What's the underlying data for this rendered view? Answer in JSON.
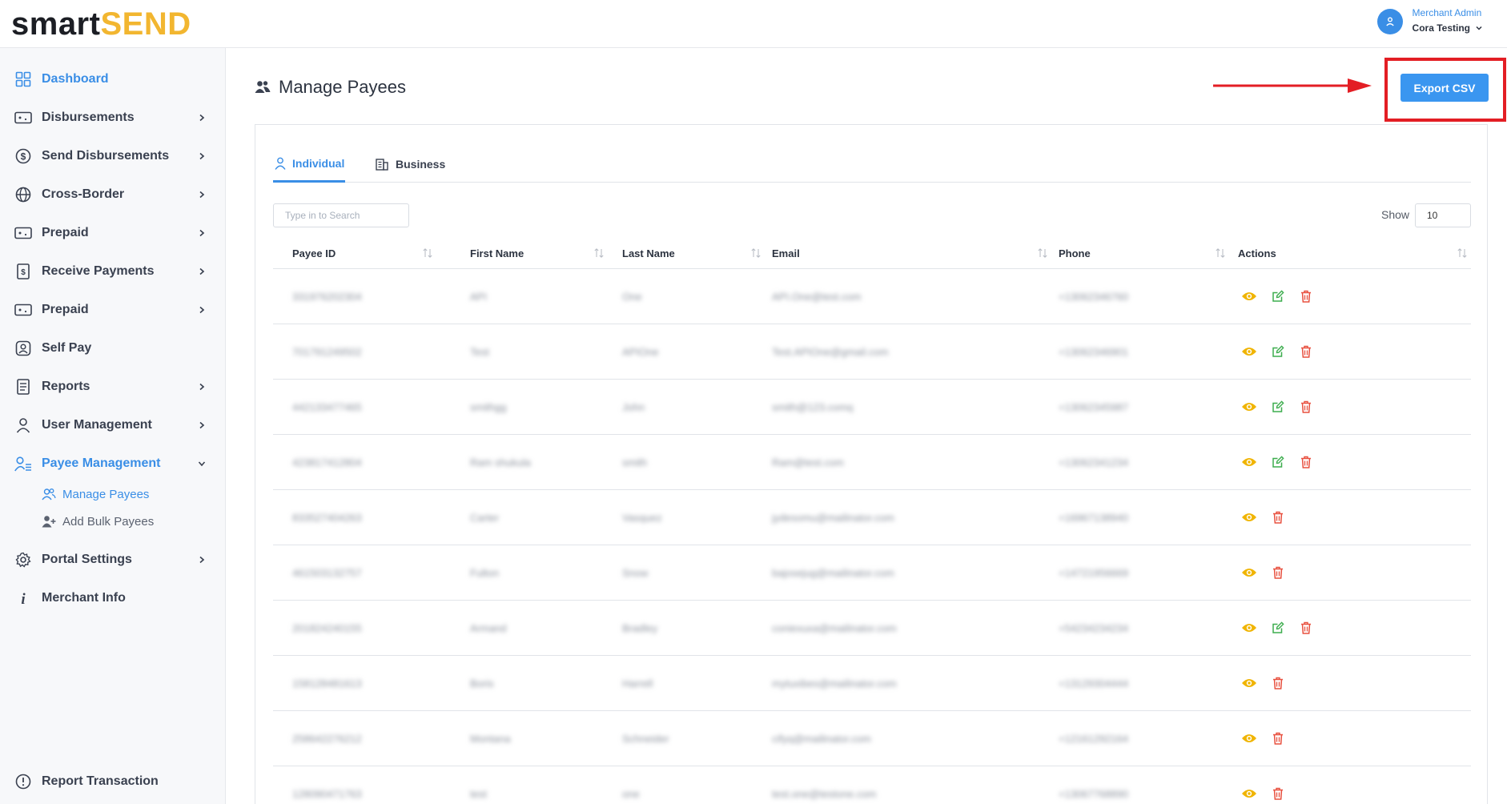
{
  "brand": {
    "part1": "smart",
    "part2": "SEND"
  },
  "user": {
    "role": "Merchant Admin",
    "name": "Cora Testing"
  },
  "sidebar": {
    "items": [
      {
        "label": "Dashboard",
        "icon": "dashboard-icon",
        "active": true,
        "has_chevron": false
      },
      {
        "label": "Disbursements",
        "icon": "cash-icon",
        "has_chevron": true
      },
      {
        "label": "Send Disbursements",
        "icon": "dollar-circle-icon",
        "has_chevron": true
      },
      {
        "label": "Cross-Border",
        "icon": "globe-icon",
        "has_chevron": true
      },
      {
        "label": "Prepaid",
        "icon": "cash-icon",
        "has_chevron": true
      },
      {
        "label": "Receive Payments",
        "icon": "receipt-icon",
        "has_chevron": true
      },
      {
        "label": "Prepaid",
        "icon": "cash-icon",
        "has_chevron": true
      },
      {
        "label": "Self Pay",
        "icon": "user-square-icon",
        "has_chevron": false
      },
      {
        "label": "Reports",
        "icon": "report-icon",
        "has_chevron": true
      },
      {
        "label": "User Management",
        "icon": "user-icon",
        "has_chevron": true
      },
      {
        "label": "Payee Management",
        "icon": "user-list-icon",
        "active": true,
        "has_chevron": true,
        "expanded": true
      },
      {
        "label": "Portal Settings",
        "icon": "gear-icon",
        "has_chevron": true
      },
      {
        "label": "Merchant Info",
        "icon": "info-icon",
        "has_chevron": false
      }
    ],
    "sub_items": [
      {
        "label": "Manage Payees",
        "icon": "users-icon",
        "active": true
      },
      {
        "label": "Add Bulk Payees",
        "icon": "user-plus-icon"
      }
    ],
    "bottom_item": {
      "label": "Report Transaction",
      "icon": "alert-circle-icon"
    }
  },
  "page": {
    "title": "Manage Payees",
    "export_label": "Export CSV"
  },
  "tabs": [
    {
      "label": "Individual",
      "icon": "person-icon",
      "active": true
    },
    {
      "label": "Business",
      "icon": "building-icon",
      "active": false
    }
  ],
  "search": {
    "placeholder": "Type in to Search",
    "value": ""
  },
  "show": {
    "label": "Show",
    "value": "10"
  },
  "table": {
    "columns": [
      "Payee ID",
      "First Name",
      "Last Name",
      "Email",
      "Phone",
      "Actions"
    ],
    "rows": [
      {
        "id": "331976202304",
        "first": "API",
        "last": "One",
        "email": "API.One@test.com",
        "phone": "+13062346760",
        "editable": true
      },
      {
        "id": "701791249502",
        "first": "Test",
        "last": "APIOne",
        "email": "Test.APIOne@gmail.com",
        "phone": "+13062346901",
        "editable": true
      },
      {
        "id": "442133477465",
        "first": "smithgg",
        "last": "John",
        "email": "smith@123.comq",
        "phone": "+13062345987",
        "editable": true
      },
      {
        "id": "423817412804",
        "first": "Ram shukula",
        "last": "smith",
        "email": "Ram@test.com",
        "phone": "+13062341234",
        "editable": true
      },
      {
        "id": "833527404263",
        "first": "Carter",
        "last": "Vasquez",
        "email": "jydesomu@mailinator.com",
        "phone": "+16967138940",
        "editable": false
      },
      {
        "id": "461503132757",
        "first": "Fulton",
        "last": "Snow",
        "email": "bajosejug@mailinator.com",
        "phone": "+14721956669",
        "editable": false
      },
      {
        "id": "201824240155",
        "first": "Armand",
        "last": "Bradley",
        "email": "coniexuxa@mailinator.com",
        "phone": "+54234234234",
        "editable": true
      },
      {
        "id": "158128481613",
        "first": "Boris",
        "last": "Harrell",
        "email": "mytuxibes@mailinator.com",
        "phone": "+13129304444",
        "editable": false
      },
      {
        "id": "258642276212",
        "first": "Montana",
        "last": "Schneider",
        "email": "cifyq@mailinator.com",
        "phone": "+12161292164",
        "editable": false
      },
      {
        "id": "128090471763",
        "first": "test",
        "last": "one",
        "email": "test.one@testone.com",
        "phone": "+13067768890",
        "editable": false
      }
    ]
  },
  "colors": {
    "accent": "#3a8ee6",
    "brand_yellow": "#f2b630",
    "view": "#f0b400",
    "edit": "#3dad4e",
    "delete": "#e8503f",
    "highlight": "#e31e24"
  }
}
